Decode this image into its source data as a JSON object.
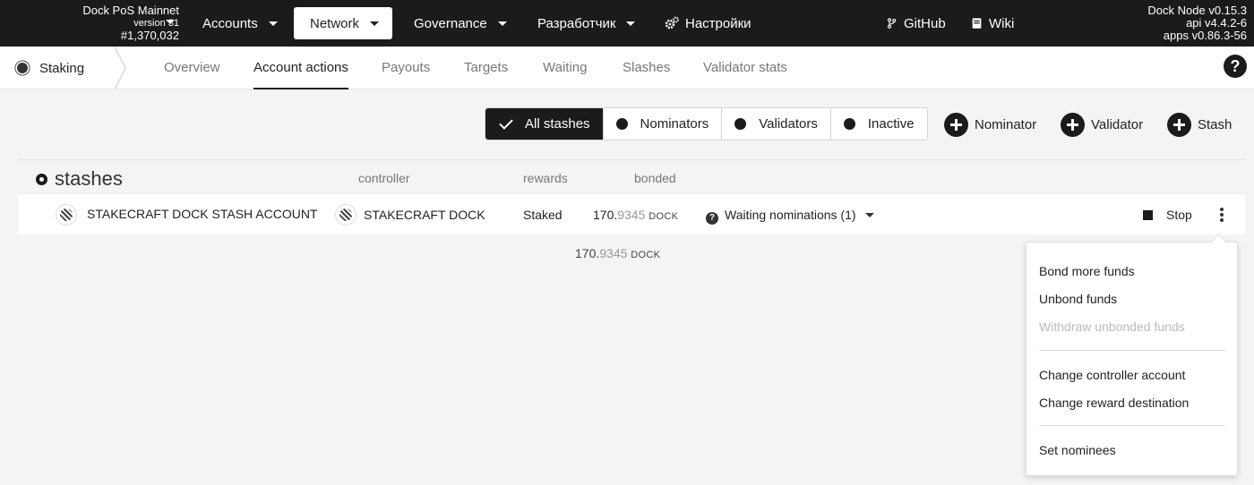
{
  "topbar": {
    "chain_name": "Dock PoS Mainnet",
    "version": "version 31",
    "block": "#1,370,032",
    "nav": [
      {
        "label": "Accounts"
      },
      {
        "label": "Network"
      },
      {
        "label": "Governance"
      },
      {
        "label": "Разработчик"
      },
      {
        "label": "Настройки"
      },
      {
        "label": "GitHub"
      },
      {
        "label": "Wiki"
      }
    ],
    "node_info": [
      "Dock Node v0.15.3",
      "api v4.4.2-6",
      "apps v0.86.3-56"
    ]
  },
  "subnav": {
    "module": "Staking",
    "tabs": [
      "Overview",
      "Account actions",
      "Payouts",
      "Targets",
      "Waiting",
      "Slashes",
      "Validator stats"
    ],
    "active_tab": "Account actions"
  },
  "filters": [
    "All stashes",
    "Nominators",
    "Validators",
    "Inactive"
  ],
  "add_buttons": [
    "Nominator",
    "Validator",
    "Stash"
  ],
  "table": {
    "title": "stashes",
    "headers": {
      "controller": "controller",
      "rewards": "rewards",
      "bonded": "bonded"
    },
    "row": {
      "stash": "STAKECRAFT DOCK STASH ACCOUNT",
      "controller": "STAKECRAFT DOCK C",
      "rewards": "Staked",
      "bonded_int": "170.",
      "bonded_dec": "9345",
      "bonded_unit": "DOCK",
      "status": "Waiting nominations (1)",
      "stop": "Stop"
    },
    "total": {
      "int": "170.",
      "dec": "9345",
      "unit": "DOCK"
    }
  },
  "menu": {
    "items": [
      "Bond more funds",
      "Unbond funds",
      "Withdraw unbonded funds",
      "Change controller account",
      "Change reward destination",
      "Set nominees"
    ]
  }
}
